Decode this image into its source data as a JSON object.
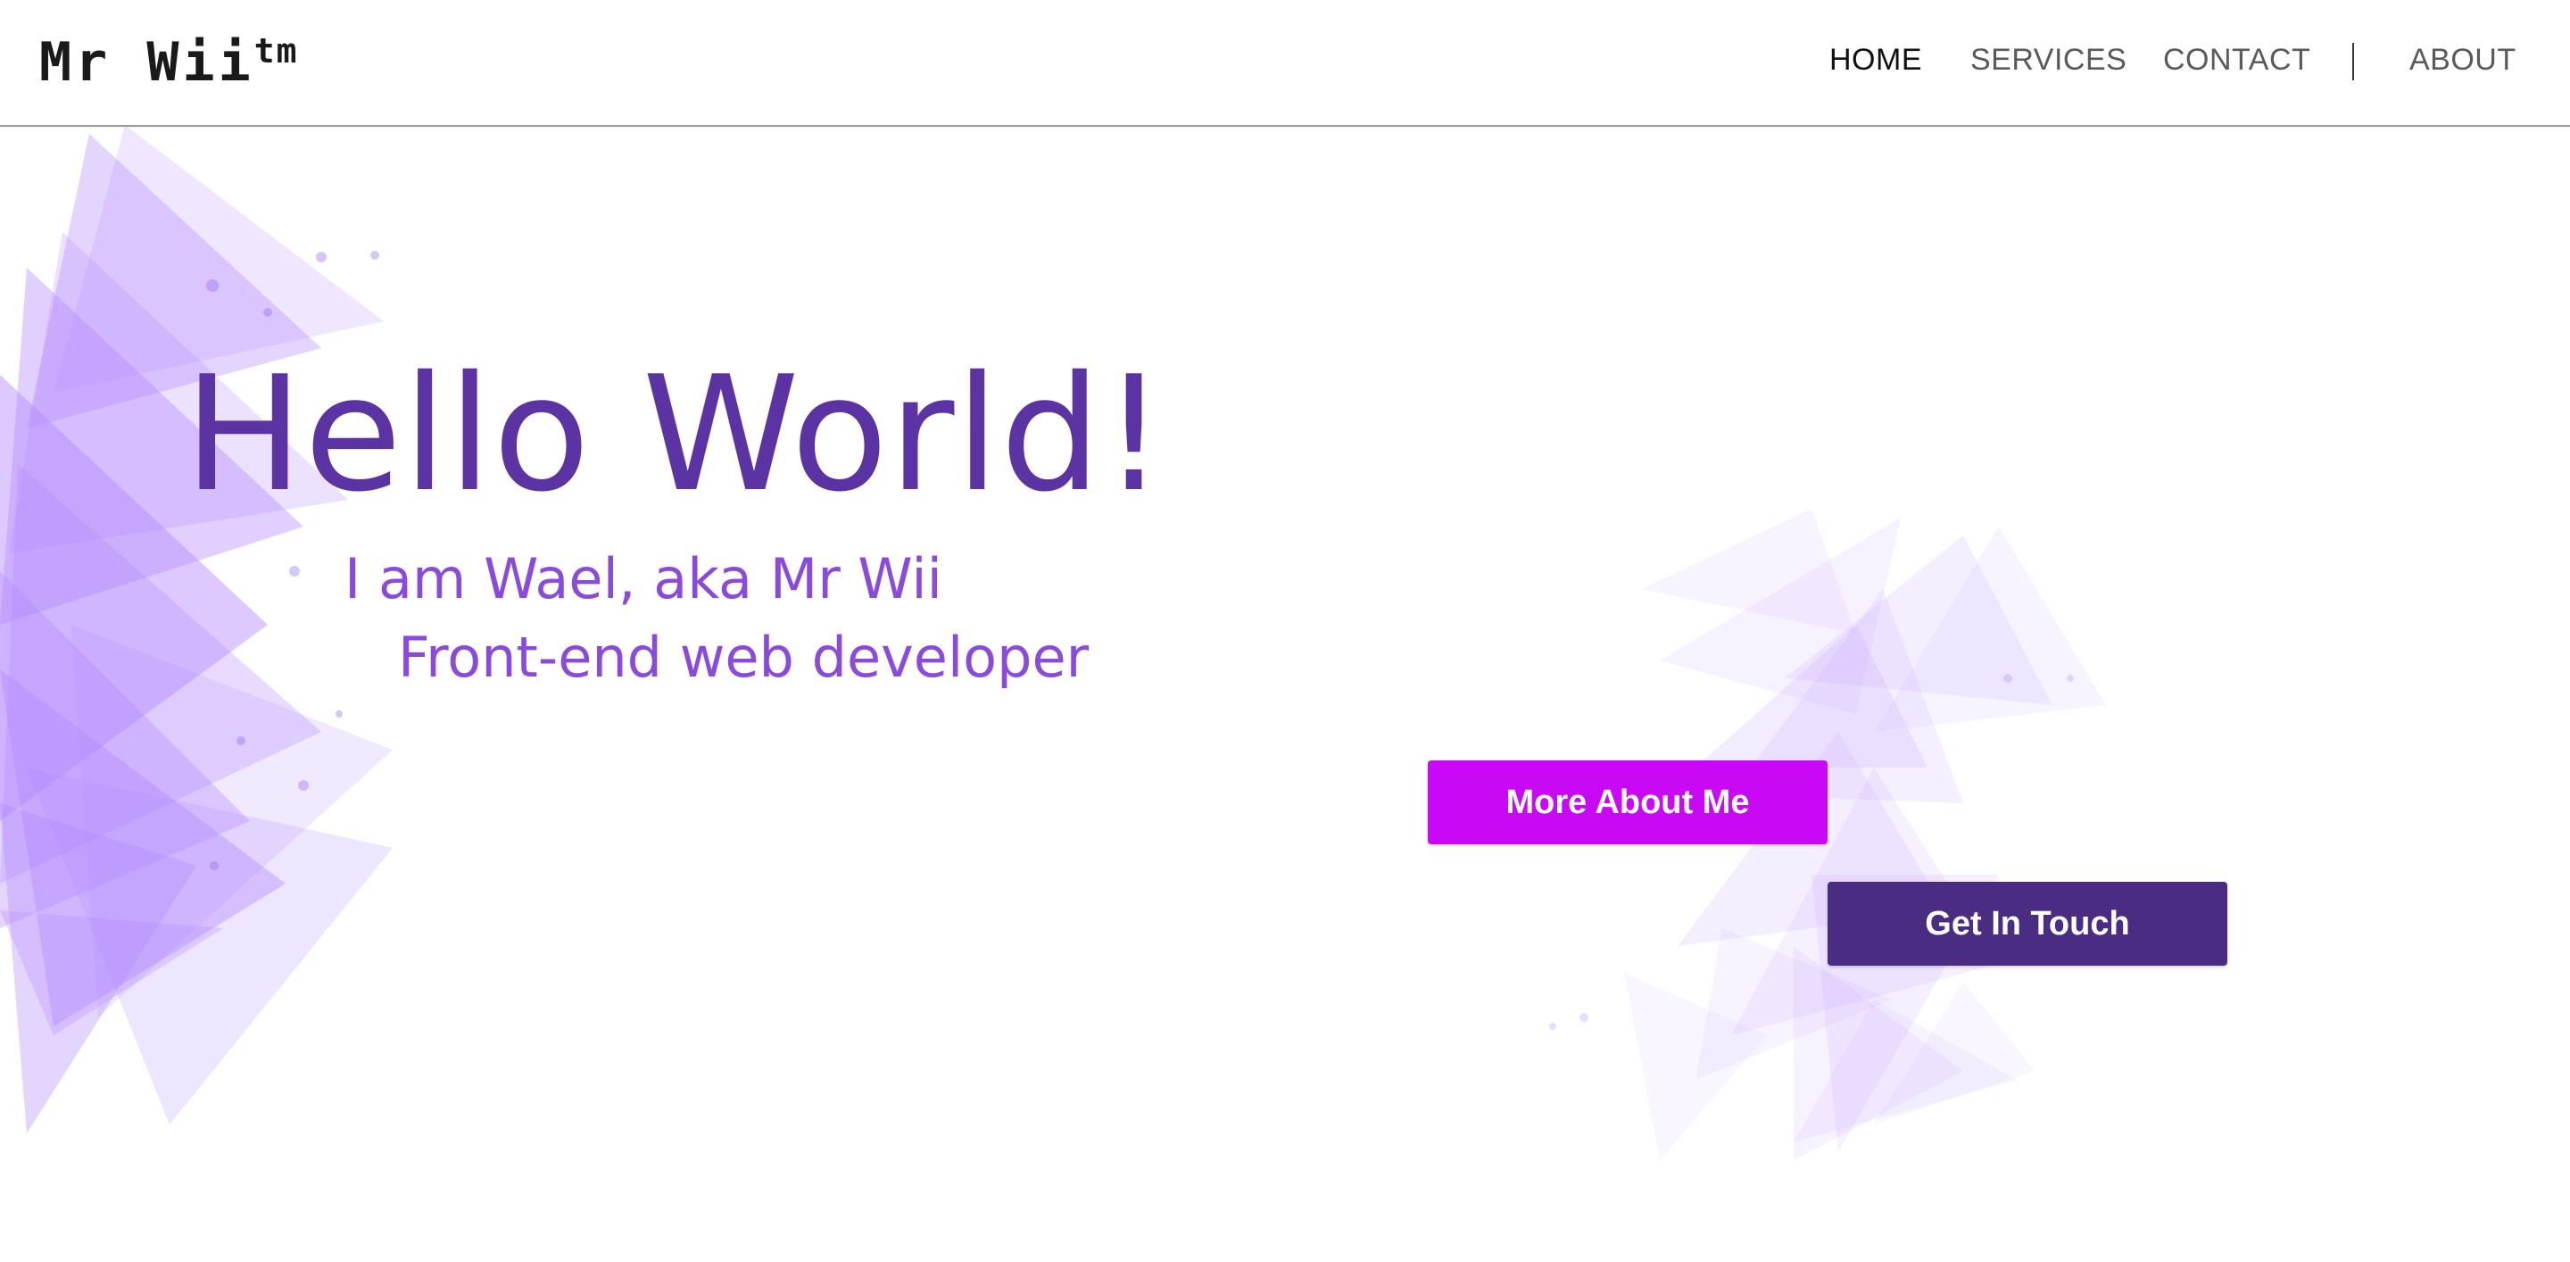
{
  "brand": {
    "logo_main": "Mr Wii",
    "logo_sup": "tm"
  },
  "nav": {
    "items": [
      {
        "label": "HOME",
        "active": true
      },
      {
        "label": "SERVICES",
        "active": false
      },
      {
        "label": "CONTACT",
        "active": false
      },
      {
        "label": "ABOUT",
        "active": false
      }
    ]
  },
  "hero": {
    "title": "Hello World!",
    "line1": "I am Wael, aka Mr Wii",
    "line2": "Front-end web developer"
  },
  "buttons": {
    "more_about_me": "More About Me",
    "get_in_touch": "Get In Touch"
  },
  "colors": {
    "title": "#5b33a3",
    "subtitle": "#8a4bdc",
    "button_more": "#c908f5",
    "button_touch": "#4a2d82",
    "decoration": "#b388ff"
  }
}
